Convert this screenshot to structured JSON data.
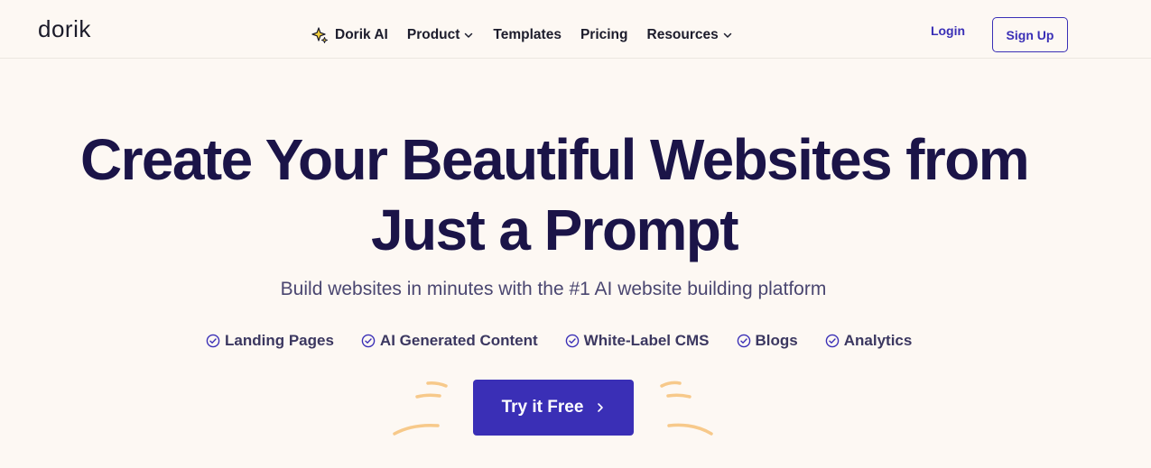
{
  "header": {
    "logo": "dorik",
    "nav": [
      {
        "label": "Dorik AI",
        "icon": "sparkle-icon"
      },
      {
        "label": "Product",
        "icon": "chevron-down-icon"
      },
      {
        "label": "Templates"
      },
      {
        "label": "Pricing"
      },
      {
        "label": "Resources",
        "icon": "chevron-down-icon"
      }
    ],
    "login_label": "Login",
    "signup_label": "Sign Up"
  },
  "hero": {
    "title_line1": "Create Your Beautiful Websites from",
    "title_line2": "Just a Prompt",
    "subtitle": "Build websites in minutes with the #1 AI website building platform",
    "features": [
      {
        "label": "Landing Pages",
        "icon": "check-circle-icon"
      },
      {
        "label": "AI Generated Content",
        "icon": "check-circle-icon"
      },
      {
        "label": "White-Label CMS",
        "icon": "check-circle-icon"
      },
      {
        "label": "Blogs",
        "icon": "check-circle-icon"
      },
      {
        "label": "Analytics",
        "icon": "check-circle-icon"
      }
    ],
    "cta_label": "Try it Free",
    "cta_icon": "chevron-right-icon"
  },
  "colors": {
    "background": "#fdf8f3",
    "primary": "#3a2fb6",
    "heading": "#1b1448",
    "doodle": "#f7c98a"
  }
}
